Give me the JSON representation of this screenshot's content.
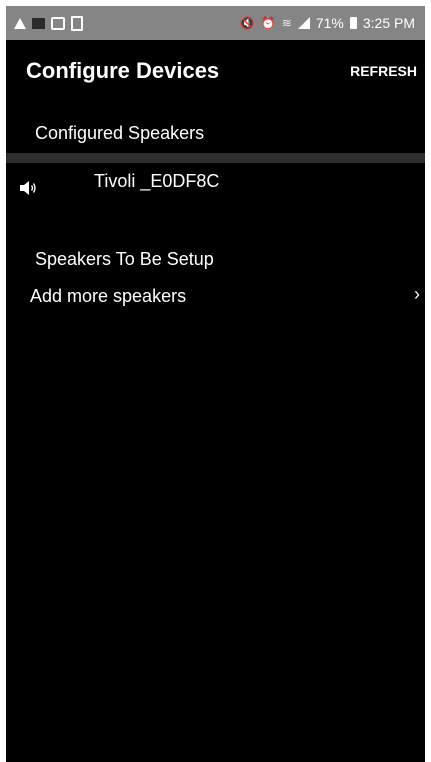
{
  "status_bar": {
    "battery_text": "71%",
    "time": "3:25 PM",
    "icons": [
      "warning-icon",
      "notification-icon",
      "image-icon",
      "clipboard-icon",
      "mute-icon",
      "alarm-icon",
      "wifi-icon",
      "signal-icon",
      "battery-icon"
    ]
  },
  "header": {
    "title": "Configure Devices",
    "refresh_label": "REFRESH"
  },
  "configured": {
    "title": "Configured Speakers",
    "speakers": [
      {
        "name": "Tivoli _E0DF8C",
        "icon": "speaker-icon"
      }
    ]
  },
  "setup": {
    "title": "Speakers To Be Setup",
    "add_more_label": "Add more speakers",
    "chevron": "›"
  },
  "colors": {
    "background": "#000000",
    "status_bar": "#858585",
    "divider": "#2d2d2d",
    "text": "#ffffff"
  }
}
